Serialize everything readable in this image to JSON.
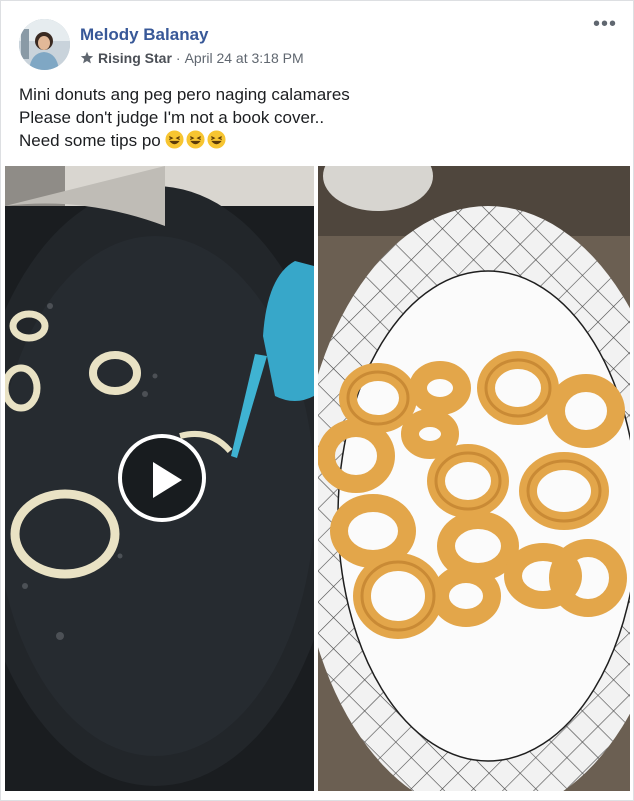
{
  "post": {
    "author": "Melody Balanay",
    "badge": "Rising Star",
    "separator": "·",
    "timestamp": "April 24 at 3:18 PM",
    "more_icon": "ellipsis-icon",
    "lines": [
      "Mini donuts ang peg pero naging calamares",
      "Please don't judge I'm not a book cover..",
      "Need some tips po"
    ],
    "emoji": [
      "laughing-face-icon",
      "laughing-face-icon",
      "laughing-face-icon"
    ]
  },
  "media": {
    "left": {
      "kind": "video",
      "play_icon": "play-icon"
    },
    "right": {
      "kind": "photo"
    }
  }
}
